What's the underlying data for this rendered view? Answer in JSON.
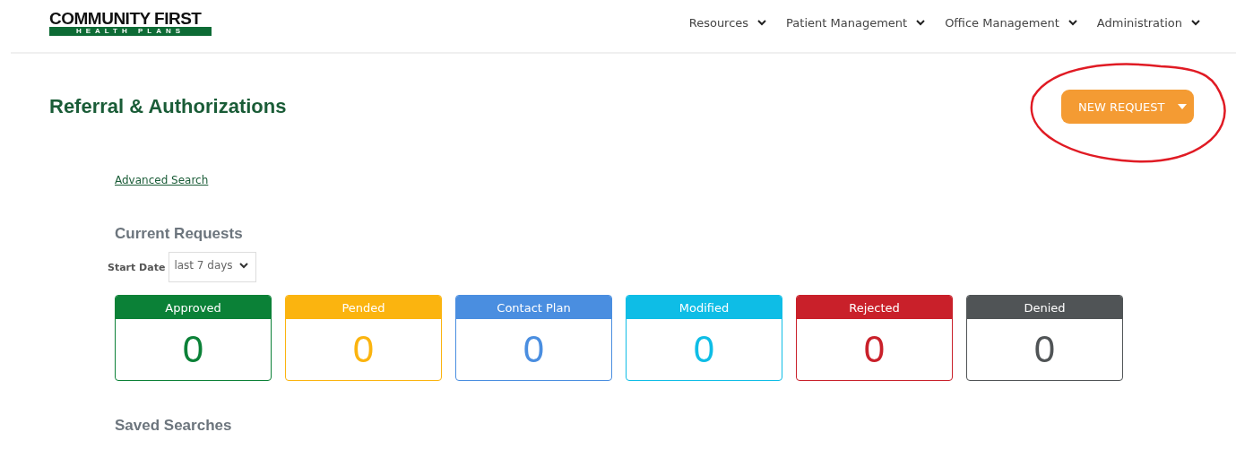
{
  "logo": {
    "name": "COMMUNITY FIRST",
    "tagline": "HEALTH PLANS"
  },
  "nav": [
    {
      "label": "Resources"
    },
    {
      "label": "Patient Management"
    },
    {
      "label": "Office Management"
    },
    {
      "label": "Administration"
    }
  ],
  "page_title": "Referral & Authorizations",
  "new_request_button": {
    "label": "NEW REQUEST"
  },
  "advanced_search_link": "Advanced Search",
  "current_requests": {
    "heading": "Current Requests",
    "start_date": {
      "label": "Start Date",
      "value": "last 7 days"
    },
    "cards": [
      {
        "label": "Approved",
        "count": "0",
        "color": "#0b8137"
      },
      {
        "label": "Pended",
        "count": "0",
        "color": "#fbb40f"
      },
      {
        "label": "Contact Plan",
        "count": "0",
        "color": "#4a8ee0"
      },
      {
        "label": "Modified",
        "count": "0",
        "color": "#0ebde6"
      },
      {
        "label": "Rejected",
        "count": "0",
        "color": "#c9202a"
      },
      {
        "label": "Denied",
        "count": "0",
        "color": "#505456"
      }
    ]
  },
  "saved_searches_heading": "Saved Searches"
}
